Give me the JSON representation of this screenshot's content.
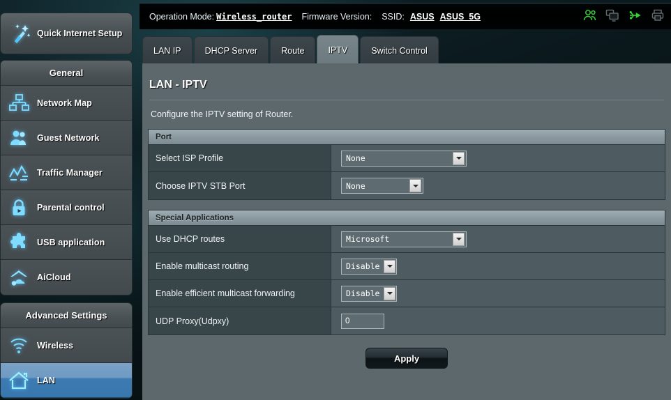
{
  "sidebar": {
    "quick_setup": {
      "label": "Quick Internet Setup",
      "icon": "magic-wand-icon"
    },
    "general_header": "General",
    "general_items": [
      {
        "label": "Network Map",
        "icon": "network-map-icon"
      },
      {
        "label": "Guest Network",
        "icon": "guest-network-icon"
      },
      {
        "label": "Traffic Manager",
        "icon": "traffic-manager-icon"
      },
      {
        "label": "Parental control",
        "icon": "lock-icon"
      },
      {
        "label": "USB application",
        "icon": "puzzle-piece-icon"
      },
      {
        "label": "AiCloud",
        "icon": "aicloud-icon"
      }
    ],
    "advanced_header": "Advanced Settings",
    "advanced_items": [
      {
        "label": "Wireless",
        "icon": "wifi-icon",
        "selected": false
      },
      {
        "label": "LAN",
        "icon": "home-icon",
        "selected": true
      }
    ]
  },
  "topbar": {
    "operation_mode_label": "Operation Mode:",
    "operation_mode_value": "Wireless_router",
    "firmware_label": "Firmware Version:",
    "firmware_value": "",
    "ssid_label": "SSID:",
    "ssid_values": [
      "ASUS",
      "ASUS_5G"
    ],
    "icons": [
      "clients-icon",
      "monitors-icon",
      "usb-icon",
      "printer-icon"
    ],
    "icon_colors": {
      "active": "#35d13a",
      "inactive": "#5e6a6d"
    }
  },
  "tabs": [
    {
      "label": "LAN IP",
      "active": false
    },
    {
      "label": "DHCP Server",
      "active": false
    },
    {
      "label": "Route",
      "active": false
    },
    {
      "label": "IPTV",
      "active": true
    },
    {
      "label": "Switch Control",
      "active": false
    }
  ],
  "main": {
    "title": "LAN - IPTV",
    "description": "Configure the IPTV setting of Router.",
    "sections": [
      {
        "header": "Port",
        "rows": [
          {
            "label": "Select ISP Profile",
            "control": "select",
            "value": "None",
            "width": "wide"
          },
          {
            "label": "Choose IPTV STB Port",
            "control": "select",
            "value": "None",
            "width": "mid"
          }
        ]
      },
      {
        "header": "Special Applications",
        "rows": [
          {
            "label": "Use DHCP routes",
            "control": "select",
            "value": "Microsoft",
            "width": "wide"
          },
          {
            "label": "Enable multicast routing",
            "control": "select",
            "value": "Disable",
            "width": "narrow"
          },
          {
            "label": "Enable efficient multicast forwarding",
            "control": "select",
            "value": "Disable",
            "width": "narrow"
          },
          {
            "label": "UDP Proxy(Udpxy)",
            "control": "input",
            "value": "0"
          }
        ]
      }
    ],
    "apply_label": "Apply"
  }
}
